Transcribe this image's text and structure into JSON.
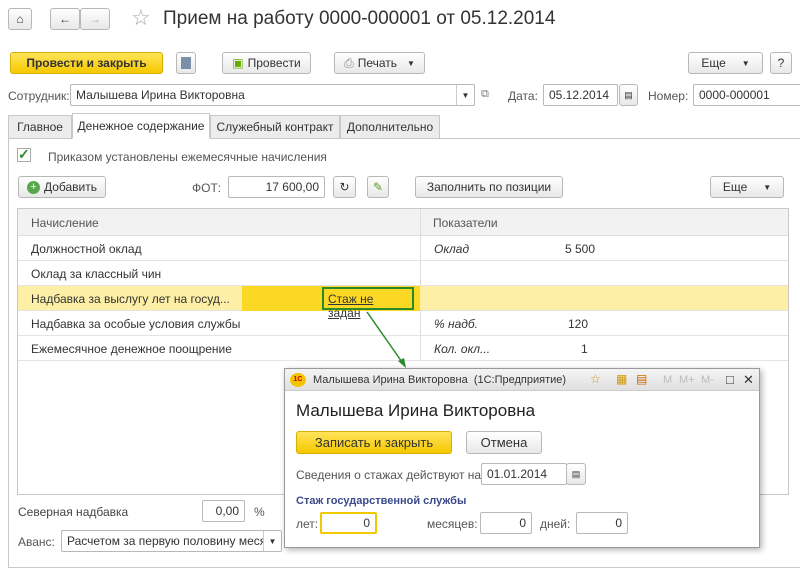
{
  "header": {
    "title": "Прием на работу 0000-000001 от 05.12.2014"
  },
  "toolbar": {
    "post_close": "Провести и закрыть",
    "post": "Провести",
    "print": "Печать",
    "more": "Еще",
    "help": "?"
  },
  "fields": {
    "employee_label": "Сотрудник:",
    "employee": "Малышева Ирина Викторовна",
    "date_label": "Дата:",
    "date": "05.12.2014",
    "number_label": "Номер:",
    "number": "0000-000001"
  },
  "tabs": [
    "Главное",
    "Денежное содержание",
    "Служебный контракт",
    "Дополнительно"
  ],
  "panel": {
    "checkbox_label": "Приказом установлены ежемесячные начисления",
    "add": "Добавить",
    "fot_label": "ФОТ:",
    "fot": "17 600,00",
    "fill": "Заполнить по позиции",
    "more": "Еще"
  },
  "table": {
    "headers": [
      "Начисление",
      "Показатели"
    ],
    "rows": [
      {
        "name": "Должностной оклад",
        "ind": "Оклад",
        "val": "5 500"
      },
      {
        "name": "Оклад за классный чин",
        "ind": "",
        "val": ""
      },
      {
        "name": "Надбавка за выслугу лет на госуд...",
        "link": "Стаж не задан",
        "ind": "",
        "val": ""
      },
      {
        "name": "Надбавка за особые условия службы",
        "ind": "% надб.",
        "val": "120"
      },
      {
        "name": "Ежемесячное денежное поощрение",
        "ind": "Кол. окл...",
        "val": "1"
      }
    ]
  },
  "bottom": {
    "north_label": "Северная надбавка",
    "north": "0,00",
    "percent": "%",
    "advance_label": "Аванс:",
    "advance": "Расчетом за первую половину меся"
  },
  "dialog": {
    "title": "Малышева Ирина Викторовна  (1С:Предприятие)",
    "heading": "Малышева Ирина Викторовна",
    "save": "Записать и закрыть",
    "cancel": "Отмена",
    "date_label": "Сведения о стажах действуют на:",
    "date": "01.01.2014",
    "section": "Стаж государственной службы",
    "years_label": "лет:",
    "years": "0",
    "months_label": "месяцев:",
    "months": "0",
    "days_label": "дней:",
    "days": "0",
    "m": "M",
    "mplus": "M+",
    "mminus": "M-",
    "logo": "1С"
  }
}
